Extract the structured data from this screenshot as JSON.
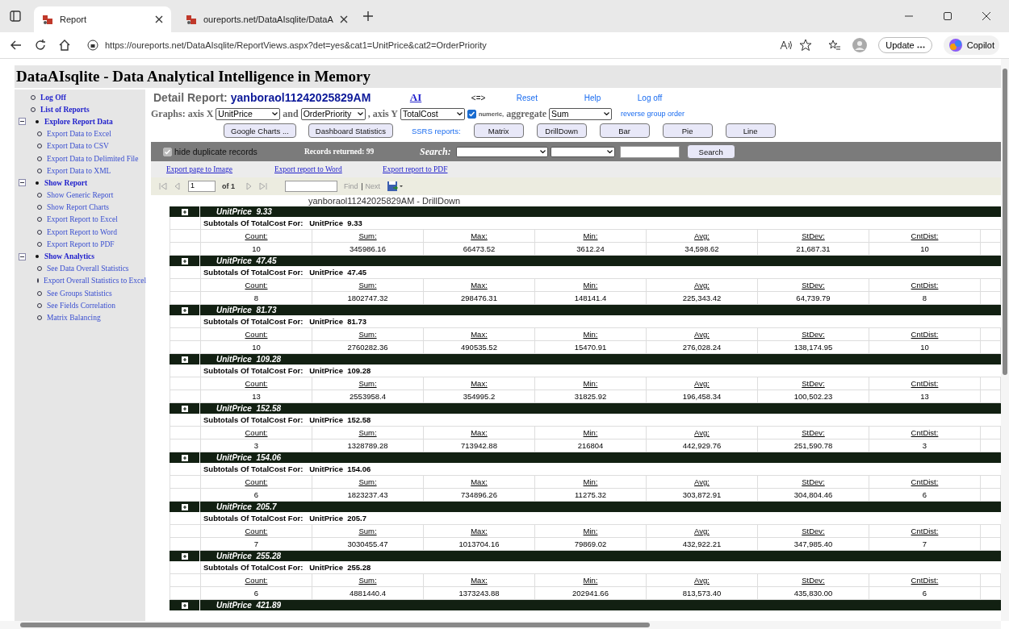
{
  "browser": {
    "tabs": [
      {
        "title": "Report",
        "selected": true
      },
      {
        "title": "oureports.net/DataAIsqlite/DataA",
        "selected": false
      }
    ],
    "url": "https://oureports.net/DataAIsqlite/ReportViews.aspx?det=yes&cat1=UnitPrice&cat2=OrderPriority",
    "update_label": "Update",
    "copilot_label": "Copilot"
  },
  "page_title": "DataAIsqlite - Data Analytical Intelligence in Memory",
  "sidebar": {
    "items": [
      {
        "label": "Log Off"
      },
      {
        "label": "List of Reports"
      },
      {
        "label": "Explore Report Data",
        "expanded": true,
        "children": [
          {
            "label": "Export Data to Excel"
          },
          {
            "label": "Export Data to CSV"
          },
          {
            "label": "Export Data to Delimited File"
          },
          {
            "label": "Export Data to XML"
          }
        ]
      },
      {
        "label": "Show Report",
        "expanded": true,
        "children": [
          {
            "label": "Show Generic Report"
          },
          {
            "label": "Show Report Charts"
          },
          {
            "label": "Export Report to Excel"
          },
          {
            "label": "Export Report to Word"
          },
          {
            "label": "Export Report to PDF"
          }
        ]
      },
      {
        "label": "Show Analytics",
        "expanded": true,
        "children": [
          {
            "label": "See Data Overall Statistics"
          },
          {
            "label": "Export Overall Statistics to Excel"
          },
          {
            "label": "See Groups Statistics"
          },
          {
            "label": "See Fields Correlation"
          },
          {
            "label": "Matrix Balancing"
          }
        ]
      }
    ]
  },
  "header": {
    "label": "Detail Report:",
    "report_name": "yanboraol11242025829AM",
    "links": [
      "AI",
      "<=>",
      "Reset",
      "Help",
      "Log off"
    ]
  },
  "graphs": {
    "label": "Graphs: axis X",
    "axis_x": "UnitPrice",
    "and_label": "and",
    "axis_x2": "OrderPriority",
    "axis_y_label": ", axis Y",
    "axis_y": "TotalCost",
    "numeric_checked": true,
    "numeric_label": "numeric,",
    "aggregate_label": "aggregate",
    "aggregate": "Sum",
    "reverse_link": "reverse group order"
  },
  "buttons": [
    "Google Charts ...",
    "Dashboard Statistics"
  ],
  "ssrs": {
    "label": "SSRS reports:",
    "buttons": [
      "Matrix",
      "DrillDown",
      "Bar",
      "Pie",
      "Line"
    ]
  },
  "filter_bar": {
    "hide_duplicates_checked": true,
    "hide_duplicates_label": "hide duplicate records",
    "records": "Records returned: 99",
    "search_label": "Search:",
    "search_button": "Search"
  },
  "export_links": [
    "Export page to Image",
    "Export report to Word",
    "Export report to PDF"
  ],
  "viewer_toolbar": {
    "page": "1",
    "of": "of 1",
    "find": "Find",
    "next": "Next"
  },
  "report_caption": "yanboraol11242025829AM - DrillDown",
  "groups": [
    {
      "field": "UnitPrice",
      "value": "9.33",
      "subtitle": "Subtotals Of TotalCost For:",
      "sub_field": "UnitPrice",
      "sub_value": "9.33",
      "stats": [
        [
          "Count:",
          "10"
        ],
        [
          "Sum:",
          "345986.16"
        ],
        [
          "Max:",
          "66473.52"
        ],
        [
          "Min:",
          "3612.24"
        ],
        [
          "Avg:",
          "34,598.62"
        ],
        [
          "StDev:",
          "21,687.31"
        ],
        [
          "CntDist:",
          "10"
        ]
      ]
    },
    {
      "field": "UnitPrice",
      "value": "47.45",
      "subtitle": "Subtotals Of TotalCost For:",
      "sub_field": "UnitPrice",
      "sub_value": "47.45",
      "stats": [
        [
          "Count:",
          "8"
        ],
        [
          "Sum:",
          "1802747.32"
        ],
        [
          "Max:",
          "298476.31"
        ],
        [
          "Min:",
          "148141.4"
        ],
        [
          "Avg:",
          "225,343.42"
        ],
        [
          "StDev:",
          "64,739.79"
        ],
        [
          "CntDist:",
          "8"
        ]
      ]
    },
    {
      "field": "UnitPrice",
      "value": "81.73",
      "subtitle": "Subtotals Of TotalCost For:",
      "sub_field": "UnitPrice",
      "sub_value": "81.73",
      "stats": [
        [
          "Count:",
          "10"
        ],
        [
          "Sum:",
          "2760282.36"
        ],
        [
          "Max:",
          "490535.52"
        ],
        [
          "Min:",
          "15470.91"
        ],
        [
          "Avg:",
          "276,028.24"
        ],
        [
          "StDev:",
          "138,174.95"
        ],
        [
          "CntDist:",
          "10"
        ]
      ]
    },
    {
      "field": "UnitPrice",
      "value": "109.28",
      "subtitle": "Subtotals Of TotalCost For:",
      "sub_field": "UnitPrice",
      "sub_value": "109.28",
      "stats": [
        [
          "Count:",
          "13"
        ],
        [
          "Sum:",
          "2553958.4"
        ],
        [
          "Max:",
          "354995.2"
        ],
        [
          "Min:",
          "31825.92"
        ],
        [
          "Avg:",
          "196,458.34"
        ],
        [
          "StDev:",
          "100,502.23"
        ],
        [
          "CntDist:",
          "13"
        ]
      ]
    },
    {
      "field": "UnitPrice",
      "value": "152.58",
      "subtitle": "Subtotals Of TotalCost For:",
      "sub_field": "UnitPrice",
      "sub_value": "152.58",
      "stats": [
        [
          "Count:",
          "3"
        ],
        [
          "Sum:",
          "1328789.28"
        ],
        [
          "Max:",
          "713942.88"
        ],
        [
          "Min:",
          "216804"
        ],
        [
          "Avg:",
          "442,929.76"
        ],
        [
          "StDev:",
          "251,590.78"
        ],
        [
          "CntDist:",
          "3"
        ]
      ]
    },
    {
      "field": "UnitPrice",
      "value": "154.06",
      "subtitle": "Subtotals Of TotalCost For:",
      "sub_field": "UnitPrice",
      "sub_value": "154.06",
      "stats": [
        [
          "Count:",
          "6"
        ],
        [
          "Sum:",
          "1823237.43"
        ],
        [
          "Max:",
          "734896.26"
        ],
        [
          "Min:",
          "11275.32"
        ],
        [
          "Avg:",
          "303,872.91"
        ],
        [
          "StDev:",
          "304,804.46"
        ],
        [
          "CntDist:",
          "6"
        ]
      ]
    },
    {
      "field": "UnitPrice",
      "value": "205.7",
      "subtitle": "Subtotals Of TotalCost For:",
      "sub_field": "UnitPrice",
      "sub_value": "205.7",
      "stats": [
        [
          "Count:",
          "7"
        ],
        [
          "Sum:",
          "3030455.47"
        ],
        [
          "Max:",
          "1013704.16"
        ],
        [
          "Min:",
          "79869.02"
        ],
        [
          "Avg:",
          "432,922.21"
        ],
        [
          "StDev:",
          "347,985.40"
        ],
        [
          "CntDist:",
          "7"
        ]
      ]
    },
    {
      "field": "UnitPrice",
      "value": "255.28",
      "subtitle": "Subtotals Of TotalCost For:",
      "sub_field": "UnitPrice",
      "sub_value": "255.28",
      "stats": [
        [
          "Count:",
          "6"
        ],
        [
          "Sum:",
          "4881440.4"
        ],
        [
          "Max:",
          "1373243.88"
        ],
        [
          "Min:",
          "202941.66"
        ],
        [
          "Avg:",
          "813,573.40"
        ],
        [
          "StDev:",
          "435,830.00"
        ],
        [
          "CntDist:",
          "6"
        ]
      ]
    },
    {
      "field": "UnitPrice",
      "value": "421.89"
    }
  ]
}
